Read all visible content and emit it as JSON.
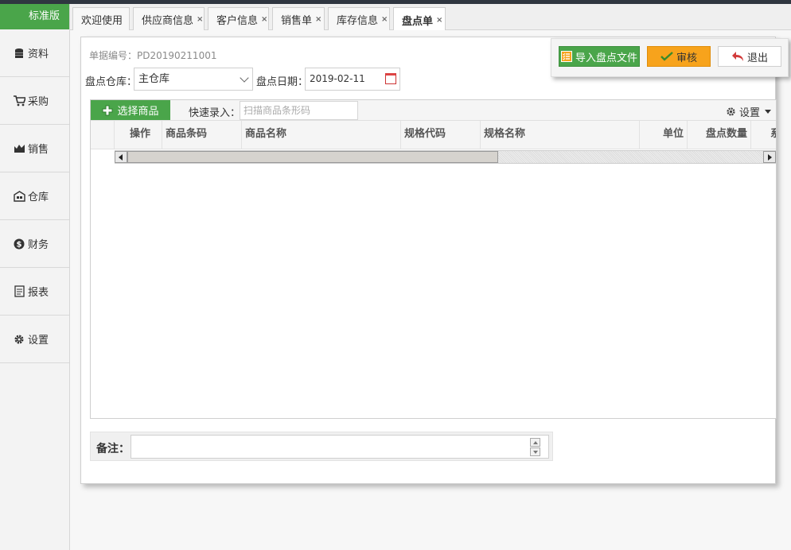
{
  "brand": {
    "label": "标准版"
  },
  "sidebar": {
    "items": [
      {
        "label": "资料",
        "icon": "database-icon"
      },
      {
        "label": "采购",
        "icon": "cart-icon"
      },
      {
        "label": "销售",
        "icon": "sales-icon"
      },
      {
        "label": "仓库",
        "icon": "warehouse-icon"
      },
      {
        "label": "财务",
        "icon": "dollar-icon"
      },
      {
        "label": "报表",
        "icon": "report-icon"
      },
      {
        "label": "设置",
        "icon": "gear-icon"
      }
    ]
  },
  "tabs": [
    {
      "label": "欢迎使用",
      "closable": false
    },
    {
      "label": "供应商信息",
      "closable": true
    },
    {
      "label": "客户信息",
      "closable": true
    },
    {
      "label": "销售单",
      "closable": true
    },
    {
      "label": "库存信息",
      "closable": true
    },
    {
      "label": "盘点单",
      "closable": true,
      "active": true
    }
  ],
  "tab_close_glyph": "×",
  "form": {
    "doc_no_label": "单据编号：",
    "doc_no_value": "PD20190211001",
    "warehouse_label": "盘点仓库：",
    "warehouse_value": "主仓库",
    "date_label": "盘点日期：",
    "date_value": "2019-02-11"
  },
  "actions": {
    "import_label": "导入盘点文件",
    "audit_label": "审核",
    "exit_label": "退出"
  },
  "grid": {
    "select_goods_label": "选择商品",
    "quick_entry_label": "快速录入：",
    "quick_entry_placeholder": "扫描商品条形码",
    "settings_label": "设置",
    "columns": [
      "操作",
      "商品条码",
      "商品名称",
      "规格代码",
      "规格名称",
      "单位",
      "盘点数量",
      "系"
    ]
  },
  "remark": {
    "label": "备注：",
    "value": ""
  },
  "colors": {
    "accent_green": "#4aa54a",
    "audit_orange": "#f7a31c"
  }
}
